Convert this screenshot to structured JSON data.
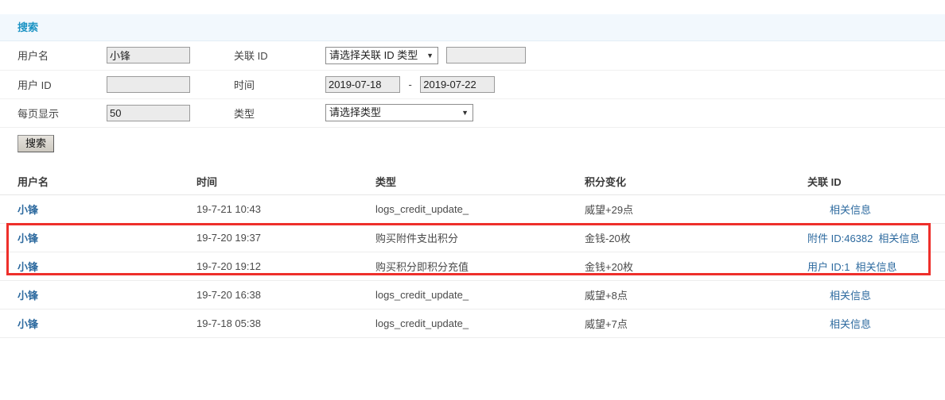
{
  "search_panel": {
    "title": "搜索",
    "rows": [
      {
        "label_left": "用户名",
        "label_right": "关联 ID"
      },
      {
        "label_left": "用户 ID",
        "label_right": "时间"
      },
      {
        "label_left": "每页显示",
        "label_right": "类型"
      }
    ],
    "fields": {
      "username": {
        "value": "小锋",
        "placeholder": ""
      },
      "userid": {
        "value": "",
        "placeholder": ""
      },
      "perpage": {
        "value": "50",
        "placeholder": ""
      },
      "assoc_type_select": {
        "selected": "请选择关联 ID 类型"
      },
      "assoc_id_input": {
        "value": "",
        "placeholder": ""
      },
      "date_start": {
        "value": "2019-07-18",
        "placeholder": ""
      },
      "date_separator": "-",
      "date_end": {
        "value": "2019-07-22",
        "placeholder": ""
      },
      "type_select": {
        "selected": "请选择类型"
      }
    },
    "submit_label": "搜索"
  },
  "results": {
    "columns": [
      "用户名",
      "时间",
      "类型",
      "积分变化",
      "关联 ID"
    ],
    "rows": [
      {
        "user": "小锋",
        "time": "19-7-21 10:43",
        "type": "logs_credit_update_",
        "credit": "威望+29点",
        "assoc_id": "",
        "assoc_link": "相关信息",
        "highlighted": false
      },
      {
        "user": "小锋",
        "time": "19-7-20 19:37",
        "type": "购买附件支出积分",
        "credit": "金钱-20枚",
        "assoc_id": "附件 ID:46382",
        "assoc_link": "相关信息",
        "highlighted": true
      },
      {
        "user": "小锋",
        "time": "19-7-20 19:12",
        "type": "购买积分即积分充值",
        "credit": "金钱+20枚",
        "assoc_id": "用户 ID:1",
        "assoc_link": "相关信息",
        "highlighted": true
      },
      {
        "user": "小锋",
        "time": "19-7-20 16:38",
        "type": "logs_credit_update_",
        "credit": "威望+8点",
        "assoc_id": "",
        "assoc_link": "相关信息",
        "highlighted": false
      },
      {
        "user": "小锋",
        "time": "19-7-18 05:38",
        "type": "logs_credit_update_",
        "credit": "威望+7点",
        "assoc_id": "",
        "assoc_link": "相关信息",
        "highlighted": false
      }
    ]
  },
  "annotation": {
    "highlight_color": "#ee2f2b"
  },
  "theme": {
    "panel_header_bg": "#f2f8fd",
    "panel_title_color": "#1b93c4",
    "link_color": "#2d6a9f",
    "text_color": "#444444"
  }
}
